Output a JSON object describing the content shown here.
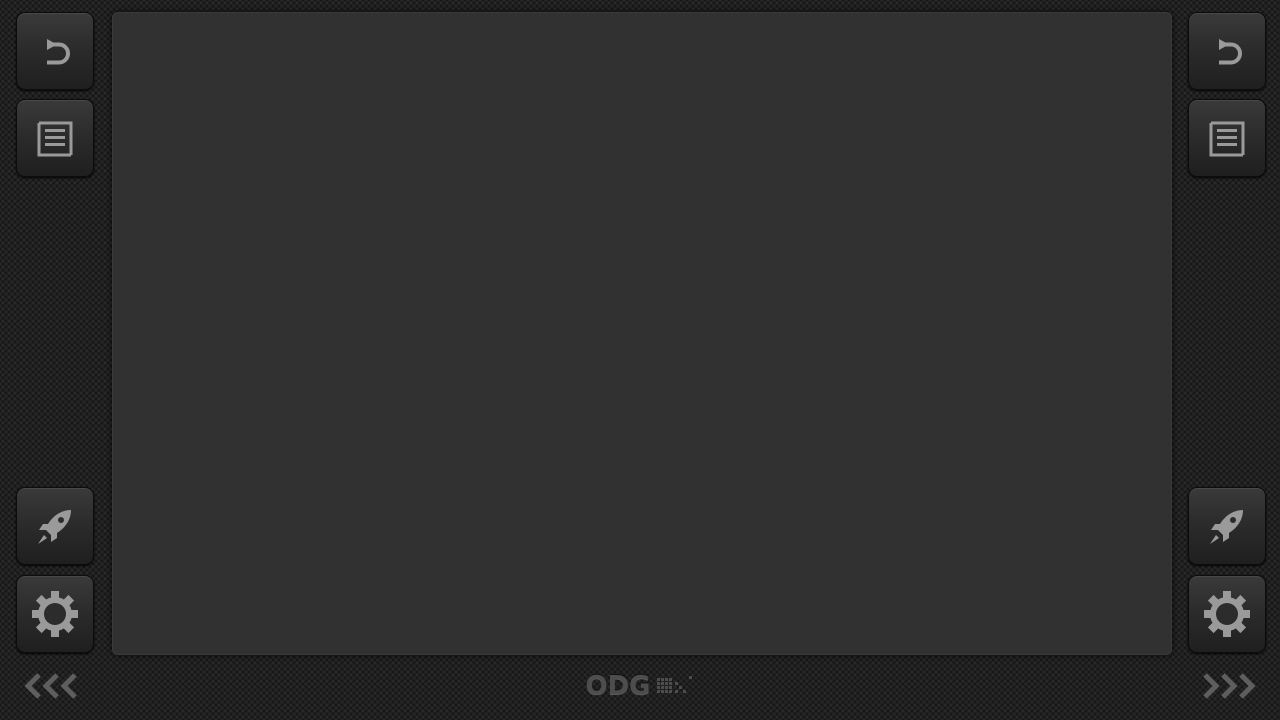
{
  "screen": {
    "background": "#313131"
  },
  "left_column": [
    {
      "icon": "undo-icon"
    },
    {
      "icon": "list-icon"
    },
    {
      "icon": "rocket-icon"
    },
    {
      "icon": "gear-icon"
    }
  ],
  "right_column": [
    {
      "icon": "undo-icon"
    },
    {
      "icon": "list-icon"
    },
    {
      "icon": "rocket-icon"
    },
    {
      "icon": "gear-icon"
    }
  ],
  "footer": {
    "logo_text": "ODG",
    "prev_icon": "triple-chevron-left-icon",
    "next_icon": "triple-chevron-right-icon"
  },
  "colors": {
    "icon": "#9a9a9a",
    "button": "#2c2c2c",
    "background": "#151515",
    "logo": "#4d4d4d"
  }
}
